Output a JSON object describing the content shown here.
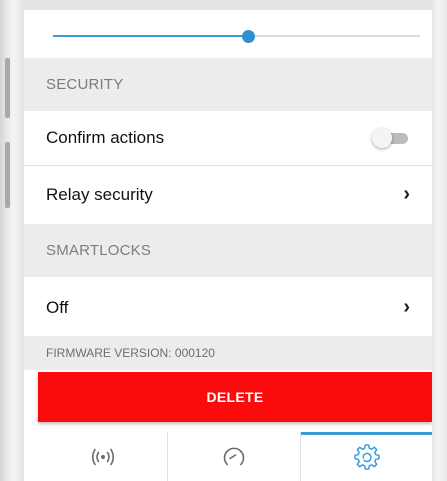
{
  "slider": {
    "value_fraction": 0.53
  },
  "security": {
    "header": "SECURITY",
    "confirm_actions": {
      "label": "Confirm actions",
      "enabled": false
    },
    "relay_security": {
      "label": "Relay security"
    }
  },
  "smartlocks": {
    "header": "SMARTLOCKS",
    "value": {
      "label": "Off"
    }
  },
  "firmware": {
    "text": "FIRMWARE VERSION: 000120"
  },
  "delete_button": {
    "label": "DELETE"
  },
  "tabbar": {
    "active_index": 2,
    "tabs": [
      {
        "icon": "radio-signal-icon"
      },
      {
        "icon": "gauge-icon"
      },
      {
        "icon": "settings-gear-icon"
      }
    ]
  },
  "colors": {
    "accent": "#3b9dd6",
    "danger": "#fb0b0b",
    "section_bg": "#ececec"
  }
}
